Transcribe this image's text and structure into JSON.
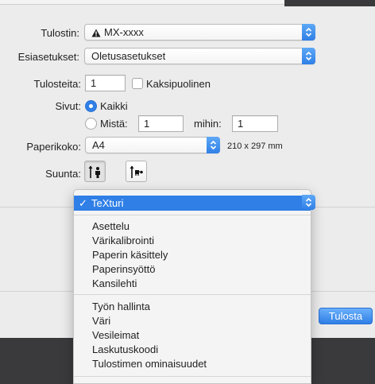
{
  "printer": {
    "label": "Tulostin:",
    "value": "MX-xxxx"
  },
  "presets": {
    "label": "Esiasetukset:",
    "value": "Oletusasetukset"
  },
  "copies": {
    "label": "Tulosteita:",
    "value": "1",
    "two_sided_label": "Kaksipuolinen"
  },
  "pages": {
    "label": "Sivut:",
    "all_label": "Kaikki",
    "from_label": "Mistä:",
    "from_value": "1",
    "to_label": "mihin:",
    "to_value": "1"
  },
  "paper": {
    "label": "Paperikoko:",
    "value": "A4",
    "dimensions": "210 x 297 mm"
  },
  "orientation": {
    "label": "Suunta:"
  },
  "print_button": "Tulosta",
  "menu": {
    "selected": "TeXturi",
    "checkmark": "✓",
    "group1": [
      "Asettelu",
      "Värikalibrointi",
      "Paperin käsittely",
      "Paperinsyöttö",
      "Kansilehti"
    ],
    "group2": [
      "Työn hallinta",
      "Väri",
      "Vesileimat",
      "Laskutuskoodi",
      "Tulostimen ominaisuudet"
    ]
  },
  "colors": {
    "accent": "#2f7fe6",
    "dialog_bg": "#ececec",
    "backdrop": "#3a3a3c"
  }
}
